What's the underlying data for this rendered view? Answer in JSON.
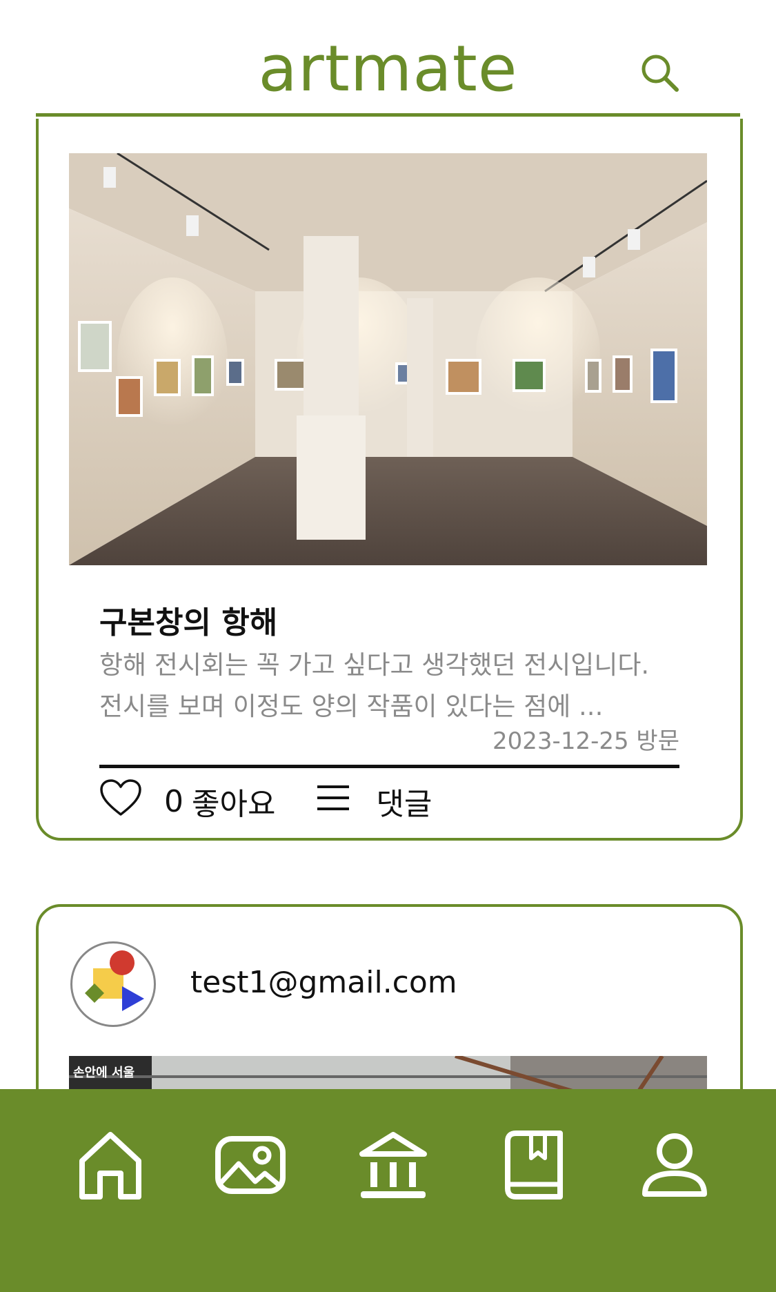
{
  "app": {
    "logo": "artmate"
  },
  "header": {
    "search_icon": "search-icon"
  },
  "posts": [
    {
      "title": "구본창의 항해",
      "description": "항해 전시회는 꼭 가고 싶다고 생각했던 전시입니다. 전시를 보며 이정도 양의 작품이 있다는 점에 ...",
      "visit_date": "2023-12-25 방문",
      "likes": "0",
      "like_label": "좋아요",
      "comment_label": "댓글"
    },
    {
      "author": "test1@gmail.com",
      "photo_caption": "손안에 서울"
    }
  ],
  "tabbar": {
    "items": [
      "home-icon",
      "gallery-icon",
      "museum-icon",
      "book-icon",
      "profile-icon"
    ]
  },
  "colors": {
    "accent": "#6a8c2a",
    "text": "#111111",
    "muted": "#8a8a8a"
  }
}
